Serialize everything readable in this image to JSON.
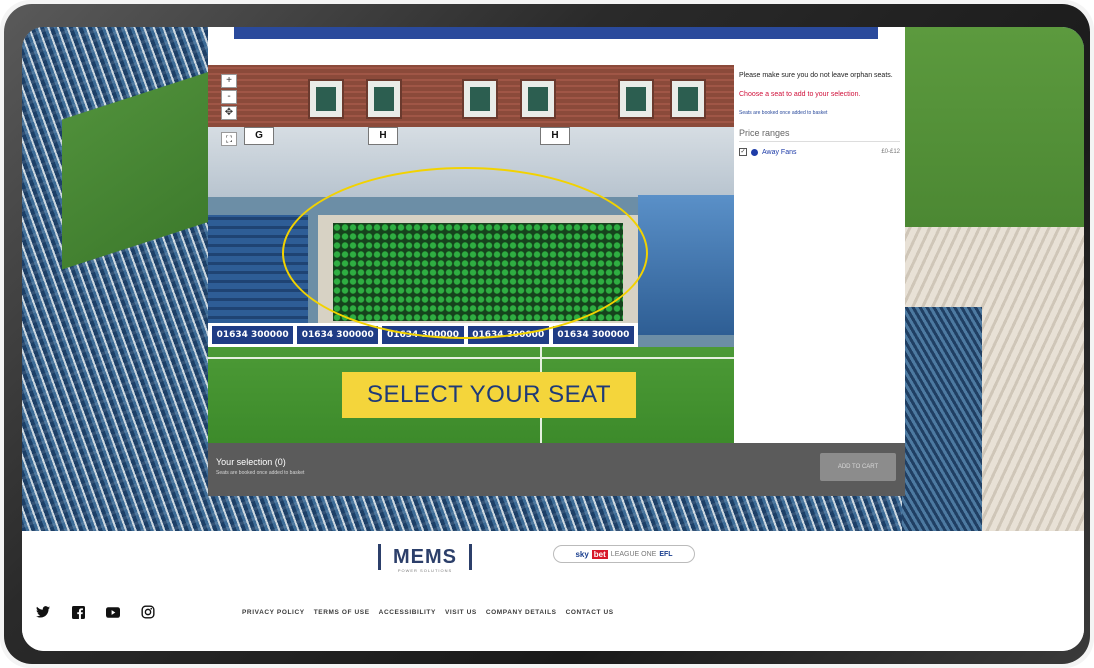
{
  "cta": {
    "label": "SELECT YOUR SEAT"
  },
  "map": {
    "zoom_in": "+",
    "zoom_out": "-",
    "section_labels": [
      "G",
      "H",
      "H"
    ],
    "ad_boards": [
      "01634 300000",
      "01634 300000",
      "01634 300000",
      "01634 300000",
      "01634 300000"
    ]
  },
  "info": {
    "orphan_note": "Please make sure you do not leave orphan seats.",
    "choose_note": "Choose a seat to add to your selection.",
    "basket_note": "Seats are booked once added to basket",
    "price_ranges_title": "Price ranges",
    "price_items": [
      {
        "name": "Away Fans",
        "value": "£0-£12"
      }
    ]
  },
  "selection": {
    "title": "Your selection (0)",
    "subtitle": "Seats are booked once added to basket",
    "add_button": "ADD TO CART"
  },
  "footer": {
    "mems_logo": "MEMS",
    "mems_sub": "POWER SOLUTIONS",
    "league": {
      "sky": "sky",
      "bet": "bet",
      "league": "LEAGUE ONE",
      "efl": "EFL"
    },
    "links": [
      "PRIVACY POLICY",
      "TERMS OF USE",
      "ACCESSIBILITY",
      "VISIT US",
      "COMPANY DETAILS",
      "CONTACT US"
    ],
    "social_icons": [
      "twitter-icon",
      "facebook-icon",
      "youtube-icon",
      "instagram-icon"
    ]
  },
  "colors": {
    "cta_bg": "#f4d53b",
    "cta_text": "#1e3a78",
    "highlight": "#f2d200",
    "selection_bar": "#5b5b5b",
    "brand_blue": "#2a4a9c"
  }
}
